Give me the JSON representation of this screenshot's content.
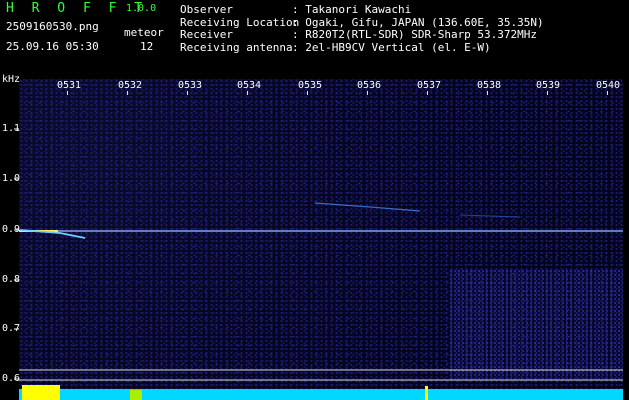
{
  "app": {
    "title": "H R O F F T",
    "version": "1.0.0"
  },
  "capture": {
    "filename": "2509160530.png",
    "datetime": "25.09.16 05:30"
  },
  "meteor": {
    "label": "meteor",
    "count": "12"
  },
  "info": [
    {
      "key": "Observer",
      "value": ": Takanori Kawachi"
    },
    {
      "key": "Receiving Location",
      "value": ": Ogaki, Gifu, JAPAN (136.60E, 35.35N)"
    },
    {
      "key": "Receiver",
      "value": ": R820T2(RTL-SDR) SDR-Sharp 53.372MHz"
    },
    {
      "key": "Receiving antenna",
      "value": ": 2el-HB9CV Vertical (el. E-W)"
    }
  ],
  "axis": {
    "y_unit": "kHz",
    "y_ticks": [
      "1.1",
      "1.0",
      "0.9",
      "0.8",
      "0.7",
      "0.6"
    ],
    "x_ticks": [
      "0531",
      "0532",
      "0533",
      "0534",
      "0535",
      "0536",
      "0537",
      "0538",
      "0539",
      "0540"
    ]
  },
  "colors": {
    "title": "#33ff33",
    "ticks": "#ffff00",
    "signal": "#6fd0ff",
    "baseline": "#00e5ff"
  }
}
